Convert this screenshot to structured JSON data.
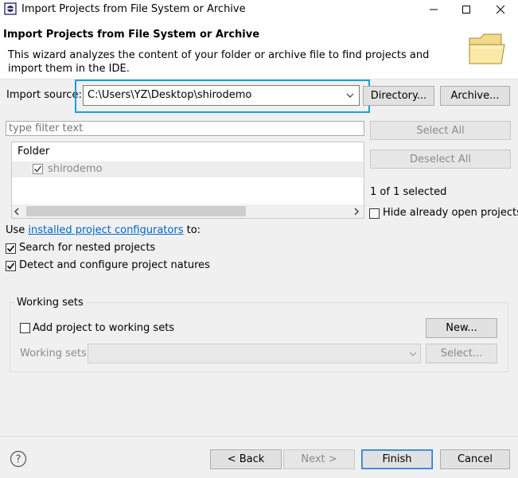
{
  "window": {
    "title": "Import Projects from File System or Archive"
  },
  "header": {
    "title": "Import Projects from File System or Archive",
    "description": "This wizard analyzes the content of your folder or archive file to find projects and import them in the IDE."
  },
  "import_source": {
    "label": "Import source:",
    "value": "C:\\Users\\YZ\\Desktop\\shirodemo"
  },
  "buttons": {
    "directory": "Directory...",
    "archive": "Archive...",
    "select_all": "Select All",
    "deselect_all": "Deselect All",
    "new": "New...",
    "select": "Select...",
    "back": "< Back",
    "next": "Next >",
    "finish": "Finish",
    "cancel": "Cancel"
  },
  "filter": {
    "placeholder": "type filter text"
  },
  "table": {
    "header": "Folder",
    "rows": [
      {
        "label": "shirodemo",
        "checked": true
      }
    ]
  },
  "selection_status": "1 of 1 selected",
  "hide_open": {
    "label": "Hide already open projects",
    "checked": false
  },
  "configurators": {
    "prefix": "Use ",
    "link": "installed project configurators",
    "suffix": " to:"
  },
  "options": {
    "search_nested": {
      "label": "Search for nested projects",
      "checked": true
    },
    "detect_natures": {
      "label": "Detect and configure project natures",
      "checked": true
    }
  },
  "working_sets": {
    "group_label": "Working sets",
    "add_label": "Add project to working sets",
    "add_checked": false,
    "field_label": "Working sets:"
  }
}
